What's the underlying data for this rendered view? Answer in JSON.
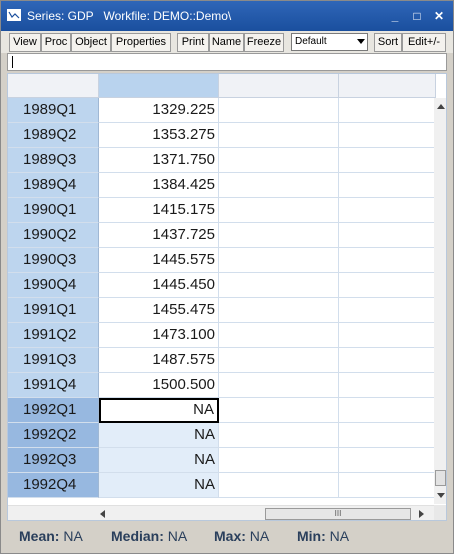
{
  "window": {
    "title": "Series: GDP   Workfile: DEMO::Demo\\",
    "minimize_label": "_",
    "maximize_label": "□",
    "close_label": "✕"
  },
  "toolbar": {
    "view": "View",
    "proc": "Proc",
    "object": "Object",
    "properties": "Properties",
    "print": "Print",
    "name": "Name",
    "freeze": "Freeze",
    "display_format": "Default",
    "sort": "Sort",
    "edit": "Edit+/-"
  },
  "edit_line": {
    "value": ""
  },
  "grid": {
    "rows": [
      {
        "label": "1989Q1",
        "value": "1329.225"
      },
      {
        "label": "1989Q2",
        "value": "1353.275"
      },
      {
        "label": "1989Q3",
        "value": "1371.750"
      },
      {
        "label": "1989Q4",
        "value": "1384.425"
      },
      {
        "label": "1990Q1",
        "value": "1415.175"
      },
      {
        "label": "1990Q2",
        "value": "1437.725"
      },
      {
        "label": "1990Q3",
        "value": "1445.575"
      },
      {
        "label": "1990Q4",
        "value": "1445.450"
      },
      {
        "label": "1991Q1",
        "value": "1455.475"
      },
      {
        "label": "1991Q2",
        "value": "1473.100"
      },
      {
        "label": "1991Q3",
        "value": "1487.575"
      },
      {
        "label": "1991Q4",
        "value": "1500.500"
      },
      {
        "label": "1992Q1",
        "value": "NA"
      },
      {
        "label": "1992Q2",
        "value": "NA"
      },
      {
        "label": "1992Q3",
        "value": "NA"
      },
      {
        "label": "1992Q4",
        "value": "NA"
      }
    ],
    "hscroll_thumb_grip": "III"
  },
  "stats": {
    "mean_label": "Mean:",
    "mean_value": "NA",
    "median_label": "Median:",
    "median_value": "NA",
    "max_label": "Max:",
    "max_value": "NA",
    "min_label": "Min:",
    "min_value": "NA"
  },
  "colors": {
    "title_bar": "#1a4f9e",
    "row_label_bg": "#bdd5ee",
    "row_label_selected_bg": "#97b8e0",
    "na_cell_bg": "#e2edf9"
  }
}
